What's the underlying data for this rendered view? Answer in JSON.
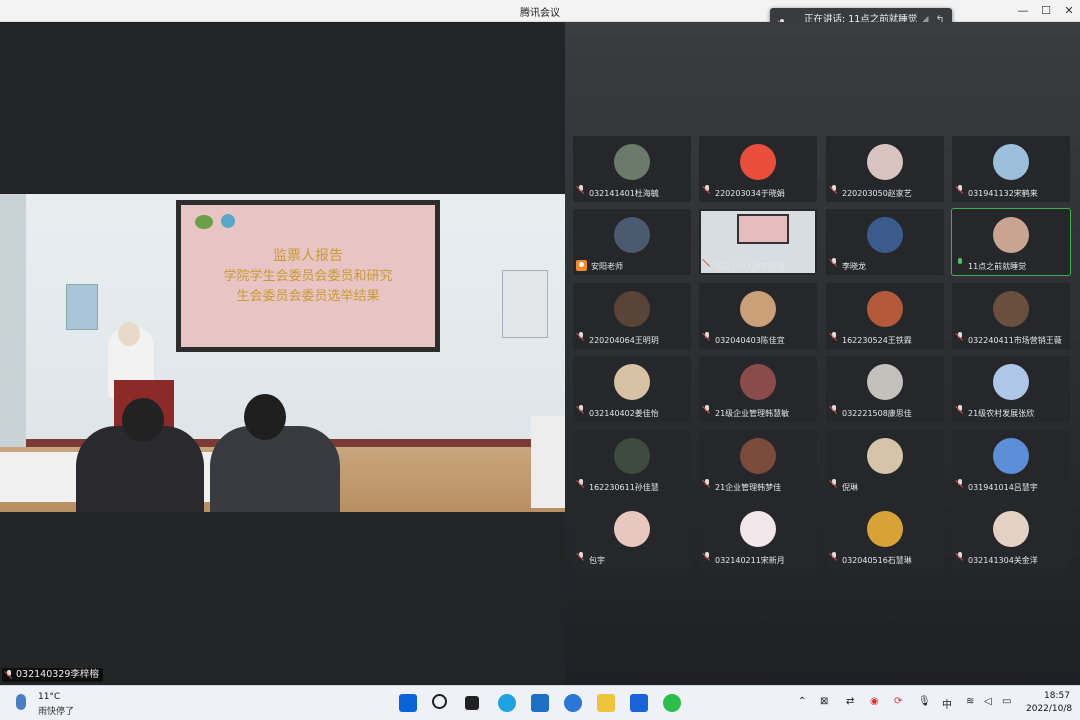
{
  "window": {
    "title": "腾讯会议",
    "minimize": "—",
    "maximize": "☐",
    "close": "✕"
  },
  "speaking": {
    "label": "正在讲话: 11点之前就睡觉"
  },
  "stage": {
    "slide_line1": "监票人报告",
    "slide_line2": "学院学生会委员会委员和研究",
    "slide_line3": "生会委员会委员选举结果",
    "speaker_name": "032140329李梓榕"
  },
  "participants": [
    {
      "name": "032141401杜海毓",
      "avatar_color": "#6b7a6a"
    },
    {
      "name": "220203034于晓娟",
      "avatar_color": "#e94e3c"
    },
    {
      "name": "220203050赵家艺",
      "avatar_color": "#d9c3c0"
    },
    {
      "name": "031941132宋鹤来",
      "avatar_color": "#9cc0db"
    },
    {
      "name": "安阳老师",
      "avatar_color": "#4b5a6e"
    },
    {
      "name": "032140329李梓榕",
      "avatar_color": "#d7dde0"
    },
    {
      "name": "李晓龙",
      "avatar_color": "#3b5b8c"
    },
    {
      "name": "11点之前就睡觉",
      "avatar_color": "#c9a591"
    },
    {
      "name": "220204064王明玥",
      "avatar_color": "#5a4438"
    },
    {
      "name": "032040403陈佳宜",
      "avatar_color": "#caa079"
    },
    {
      "name": "162230524王铁霖",
      "avatar_color": "#b45a3a"
    },
    {
      "name": "032240411市场营销王薇",
      "avatar_color": "#6b4f3e"
    },
    {
      "name": "032140402姜佳怡",
      "avatar_color": "#d8c2a5"
    },
    {
      "name": "21级企业管理韩慧敏",
      "avatar_color": "#8a4b4b"
    },
    {
      "name": "032221508康思佳",
      "avatar_color": "#c4c1bd"
    },
    {
      "name": "21级农村发展张欣",
      "avatar_color": "#aec6e8"
    },
    {
      "name": "162230611孙佳慧",
      "avatar_color": "#3f4b3f"
    },
    {
      "name": "21企业管理韩梦佳",
      "avatar_color": "#7a4a3a"
    },
    {
      "name": "倪琳",
      "avatar_color": "#d5c4a8"
    },
    {
      "name": "031941014吕慧宇",
      "avatar_color": "#5c8fd8"
    },
    {
      "name": "包宇",
      "avatar_color": "#e8c7c0"
    },
    {
      "name": "032140211宋新月",
      "avatar_color": "#f1e6ea"
    },
    {
      "name": "032040516石慧琳",
      "avatar_color": "#d9a236"
    },
    {
      "name": "032141304关金洋",
      "avatar_color": "#e3d2c4"
    }
  ],
  "taskbar": {
    "temperature": "11°C",
    "weather": "雨快停了",
    "ime": "中",
    "time": "18:57",
    "date": "2022/10/8"
  },
  "colors": {
    "accent_green": "#3fae4f",
    "host_orange": "#f08a2c"
  }
}
